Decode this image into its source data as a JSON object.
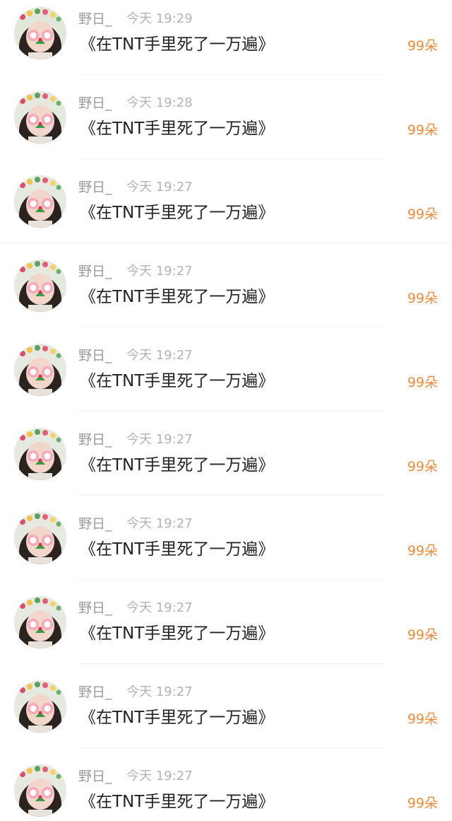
{
  "comments": [
    {
      "name": "野日_",
      "time": "今天 19:29",
      "message": "《在TNT手里死了一万遍》",
      "count": "99朵"
    },
    {
      "name": "野日_",
      "time": "今天 19:28",
      "message": "《在TNT手里死了一万遍》",
      "count": "99朵"
    },
    {
      "name": "野日_",
      "time": "今天 19:27",
      "message": "《在TNT手里死了一万遍》",
      "count": "99朵"
    },
    {
      "name": "野日_",
      "time": "今天 19:27",
      "message": "《在TNT手里死了一万遍》",
      "count": "99朵"
    },
    {
      "name": "野日_",
      "time": "今天 19:27",
      "message": "《在TNT手里死了一万遍》",
      "count": "99朵"
    },
    {
      "name": "野日_",
      "time": "今天 19:27",
      "message": "《在TNT手里死了一万遍》",
      "count": "99朵"
    },
    {
      "name": "野日_",
      "time": "今天 19:27",
      "message": "《在TNT手里死了一万遍》",
      "count": "99朵"
    },
    {
      "name": "野日_",
      "time": "今天 19:27",
      "message": "《在TNT手里死了一万遍》",
      "count": "99朵"
    },
    {
      "name": "野日_",
      "time": "今天 19:27",
      "message": "《在TNT手里死了一万遍》",
      "count": "99朵"
    },
    {
      "name": "野日_",
      "time": "今天 19:27",
      "message": "《在TNT手里死了一万遍》",
      "count": "99朵"
    }
  ],
  "colors": {
    "name": "#9a9a9a",
    "time": "#b3b3b3",
    "message": "#222222",
    "count_accent": "#f08a3c",
    "divider": "#f1f1f1"
  },
  "icons": {
    "avatar": "user-avatar-photo"
  }
}
